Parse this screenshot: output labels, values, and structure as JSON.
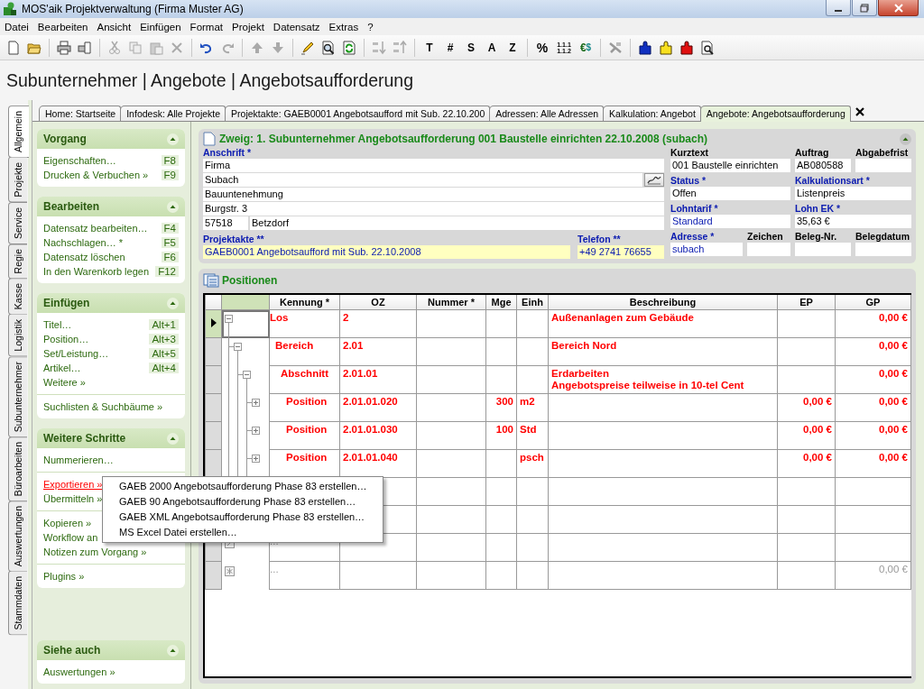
{
  "window": {
    "title": "MOS'aik Projektverwaltung (Firma Muster AG)"
  },
  "menu": [
    "Datei",
    "Bearbeiten",
    "Ansicht",
    "Einfügen",
    "Format",
    "Projekt",
    "Datensatz",
    "Extras",
    "?"
  ],
  "toolbar": {
    "glyph_buttons": [
      "T",
      "#",
      "S",
      "A",
      "Z"
    ],
    "percent": "%",
    "numbering": [
      "1.1.1",
      "1.1.2"
    ],
    "currency": [
      "€",
      "$"
    ]
  },
  "heading": "Subunternehmer | Angebote | Angebotsaufforderung",
  "tabs": [
    {
      "label": "Home: Startseite",
      "selected": false
    },
    {
      "label": "Infodesk: Alle Projekte",
      "selected": false
    },
    {
      "label": "Projektakte: GAEB0001 Angebotsaufford mit Sub. 22.10.200",
      "selected": false
    },
    {
      "label": "Adressen: Alle Adressen",
      "selected": false
    },
    {
      "label": "Kalkulation: Angebot",
      "selected": false
    },
    {
      "label": "Angebote: Angebotsaufforderung",
      "selected": true
    }
  ],
  "side_tabs": [
    {
      "label": "Allgemein",
      "selected": true
    },
    {
      "label": "Projekte",
      "selected": false
    },
    {
      "label": "Service",
      "selected": false
    },
    {
      "label": "Regie",
      "selected": false
    },
    {
      "label": "Kasse",
      "selected": false
    },
    {
      "label": "Logistik",
      "selected": false
    },
    {
      "label": "Subunternehmer",
      "selected": false
    },
    {
      "label": "Büroarbeiten",
      "selected": false
    },
    {
      "label": "Auswertungen",
      "selected": false
    },
    {
      "label": "Stammdaten",
      "selected": false
    }
  ],
  "sidebar": [
    {
      "title": "Vorgang",
      "groups": [
        [
          {
            "label": "Eigenschaften…",
            "shortcut": "F8",
            "active": false
          },
          {
            "label": "Drucken & Verbuchen »",
            "shortcut": "F9",
            "active": false
          }
        ]
      ]
    },
    {
      "title": "Bearbeiten",
      "groups": [
        [
          {
            "label": "Datensatz bearbeiten…",
            "shortcut": "F4",
            "active": false
          },
          {
            "label": "Nachschlagen… *",
            "shortcut": "F5",
            "active": false
          },
          {
            "label": "Datensatz löschen",
            "shortcut": "F6",
            "active": false
          },
          {
            "label": "In den Warenkorb legen",
            "shortcut": "F12",
            "active": false
          }
        ]
      ]
    },
    {
      "title": "Einfügen",
      "groups": [
        [
          {
            "label": "Titel…",
            "shortcut": "Alt+1",
            "active": false
          },
          {
            "label": "Position…",
            "shortcut": "Alt+3",
            "active": false
          },
          {
            "label": "Set/Leistung…",
            "shortcut": "Alt+5",
            "active": false
          },
          {
            "label": "Artikel…",
            "shortcut": "Alt+4",
            "active": false
          },
          {
            "label": "Weitere »",
            "active": false
          }
        ],
        [
          {
            "label": "Suchlisten & Suchbäume »",
            "active": false
          }
        ]
      ]
    },
    {
      "title": "Weitere Schritte",
      "groups": [
        [
          {
            "label": "Nummerieren…",
            "active": false
          }
        ],
        [
          {
            "label": "Exportieren »",
            "active": true
          },
          {
            "label": "Übermitteln »",
            "active": false
          }
        ],
        [
          {
            "label": "Kopieren »",
            "active": false
          },
          {
            "label": "Workflow an",
            "active": false
          },
          {
            "label": "Notizen zum Vorgang »",
            "active": false
          }
        ],
        [
          {
            "label": "Plugins »",
            "active": false
          }
        ]
      ]
    },
    {
      "title": "Siehe auch",
      "groups": [
        [
          {
            "label": "Auswertungen »",
            "active": false
          }
        ]
      ]
    }
  ],
  "branch": {
    "title": "Zweig: 1. Subunternehmer Angebotsaufforderung 001 Baustelle einrichten 22.10.2008 (subach)",
    "address": {
      "label": "Anschrift *",
      "required": true,
      "lines": [
        {
          "value": "Firma",
          "lookup": false
        },
        {
          "value": "Subach",
          "lookup": true
        },
        {
          "value": "Bauuntenehmung",
          "lookup": false
        },
        {
          "value": "Burgstr. 3",
          "lookup": false
        }
      ],
      "postal_code": "57518",
      "city": "Betzdorf"
    },
    "bottom_fields": [
      {
        "label": "Projektakte **",
        "required": true,
        "value": "GAEB0001 Angebotsaufford mit Sub. 22.10.2008",
        "link": true,
        "highlight": true
      },
      {
        "label": "Telefon **",
        "required": true,
        "value": "+49 2741 76655",
        "link": true,
        "highlight": true
      }
    ],
    "right_rows": [
      [
        {
          "label": "Kurztext",
          "required": false,
          "value": "001 Baustelle einrichten",
          "link": false
        },
        {
          "label": "Auftrag",
          "required": false,
          "value": "AB080588",
          "link": false
        },
        {
          "label": "Abgabefrist",
          "required": false
        }
      ],
      [
        {
          "label": "Status *",
          "required": true,
          "value": "Offen",
          "link": false
        },
        {
          "label": "Kalkulationsart *",
          "required": true,
          "value": "Listenpreis",
          "link": false
        }
      ],
      [
        {
          "label": "Lohntarif *",
          "required": true,
          "value": "Standard",
          "link": true
        },
        {
          "label": "Lohn EK *",
          "required": true,
          "value": "35,63 €",
          "link": false
        }
      ],
      [
        {
          "label": "Adresse *",
          "required": true,
          "value": "subach",
          "link": true
        },
        {
          "label": "Zeichen",
          "required": false
        },
        {
          "label": "Beleg-Nr.",
          "required": false
        },
        {
          "label": "Belegdatum",
          "required": false
        }
      ]
    ]
  },
  "positions": {
    "title": "Positionen",
    "columns": [
      "Kennung *",
      "OZ",
      "Nummer *",
      "Mge",
      "Einh",
      "Beschreibung",
      "EP",
      "GP"
    ],
    "rows": [
      {
        "kind": "item",
        "kennung": "Los",
        "oz": "2",
        "beschreibung": "Außenanlagen zum Gebäude",
        "gp": "0,00 €",
        "selected": true,
        "expanded": true,
        "children": [
          {
            "kind": "item",
            "kennung": "Bereich",
            "oz": "2.01",
            "beschreibung": "Bereich Nord",
            "gp": "0,00 €",
            "selected": false,
            "expanded": true,
            "children": [
              {
                "kind": "item",
                "kennung": "Abschnitt",
                "oz": "2.01.01",
                "beschreibung": "Erdarbeiten\nAngebotspreise teilweise in 10-tel Cent",
                "gp": "0,00 €",
                "selected": false,
                "expanded": true,
                "children": [
                  {
                    "kind": "item",
                    "kennung": "Position",
                    "oz": "2.01.01.020",
                    "mge": "300",
                    "einh": "m2",
                    "ep": "0,00 €",
                    "gp": "0,00 €",
                    "selected": false,
                    "expanded": false
                  },
                  {
                    "kind": "item",
                    "kennung": "Position",
                    "oz": "2.01.01.030",
                    "mge": "100",
                    "einh": "Std",
                    "ep": "0,00 €",
                    "gp": "0,00 €",
                    "selected": false,
                    "expanded": false
                  },
                  {
                    "kind": "item",
                    "kennung": "Position",
                    "oz": "2.01.01.040",
                    "einh": "psch",
                    "ep": "0,00 €",
                    "gp": "0,00 €",
                    "selected": false,
                    "expanded": false
                  }
                ]
              }
            ]
          }
        ]
      },
      {
        "kind": "blank"
      },
      {
        "kind": "blank"
      },
      {
        "kind": "placeholder",
        "kennung": "...",
        "selected": false
      },
      {
        "kind": "new",
        "kennung": "...",
        "gp": "0,00 €",
        "selected": false
      }
    ]
  },
  "popup_menu": {
    "items": [
      "GAEB 2000 Angebotsaufforderung Phase 83 erstellen…",
      "GAEB 90 Angebotsaufforderung Phase 83 erstellen…",
      "GAEB XML Angebotsaufforderung Phase 83 erstellen…",
      "MS Excel Datei erstellen…"
    ]
  }
}
